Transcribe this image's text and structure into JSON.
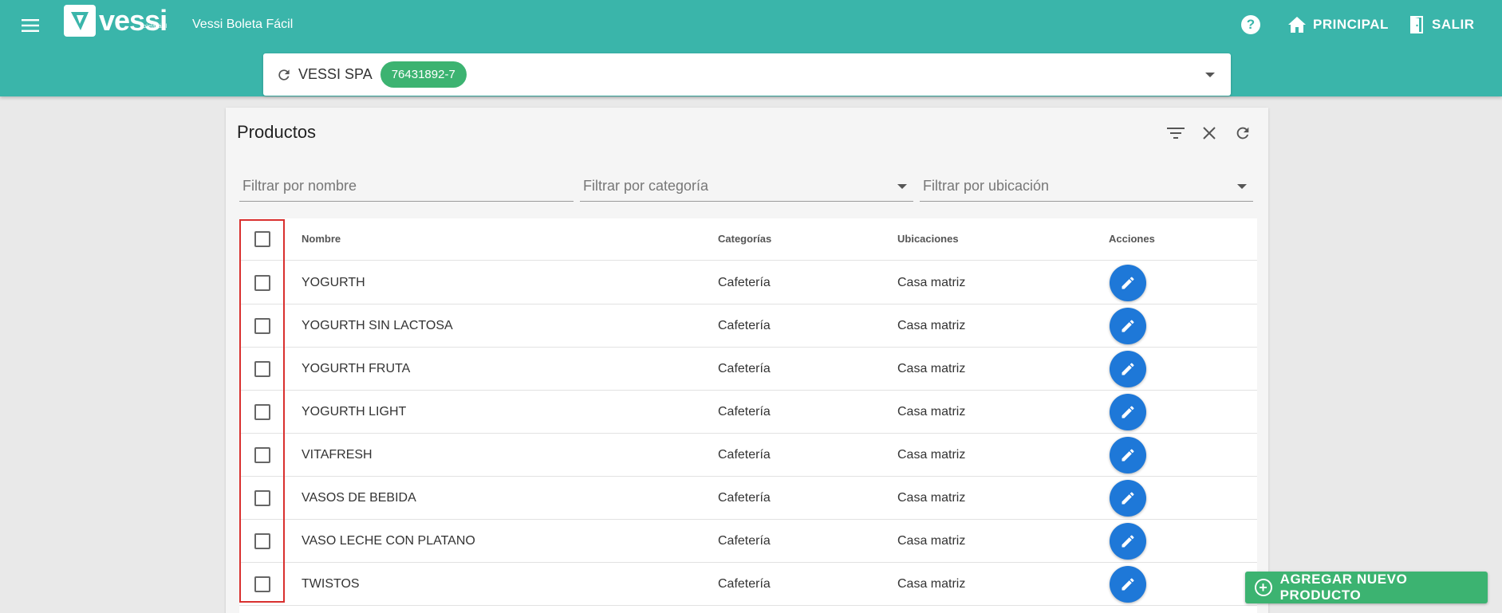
{
  "header": {
    "logo_text": "vessi",
    "logo_sub": "boleta fácil",
    "app_title": "Vessi Boleta Fácil",
    "help_icon_glyph": "?",
    "nav_principal": "PRINCIPAL",
    "nav_salir": "SALIR",
    "accent_color": "#3ab5aa"
  },
  "company": {
    "name": "VESSI SPA",
    "rut": "76431892-7"
  },
  "card": {
    "title": "Productos"
  },
  "filters": {
    "name_placeholder": "Filtrar por nombre",
    "category_placeholder": "Filtrar por categoría",
    "location_placeholder": "Filtrar por ubicación"
  },
  "table": {
    "columns": [
      "Nombre",
      "Categorías",
      "Ubicaciones",
      "Acciones"
    ],
    "rows": [
      {
        "name": "YOGURTH",
        "category": "Cafetería",
        "location": "Casa matriz"
      },
      {
        "name": "YOGURTH SIN LACTOSA",
        "category": "Cafetería",
        "location": "Casa matriz"
      },
      {
        "name": "YOGURTH FRUTA",
        "category": "Cafetería",
        "location": "Casa matriz"
      },
      {
        "name": "YOGURTH LIGHT",
        "category": "Cafetería",
        "location": "Casa matriz"
      },
      {
        "name": "VITAFRESH",
        "category": "Cafetería",
        "location": "Casa matriz"
      },
      {
        "name": "VASOS DE BEBIDA",
        "category": "Cafetería",
        "location": "Casa matriz"
      },
      {
        "name": "VASO LECHE CON PLATANO",
        "category": "Cafetería",
        "location": "Casa matriz"
      },
      {
        "name": "TWISTOS",
        "category": "Cafetería",
        "location": "Casa matriz"
      }
    ]
  },
  "actions": {
    "add_product": "AGREGAR NUEVO PRODUCTO",
    "add_color": "#3cb371",
    "edit_color": "#1e78d8"
  }
}
